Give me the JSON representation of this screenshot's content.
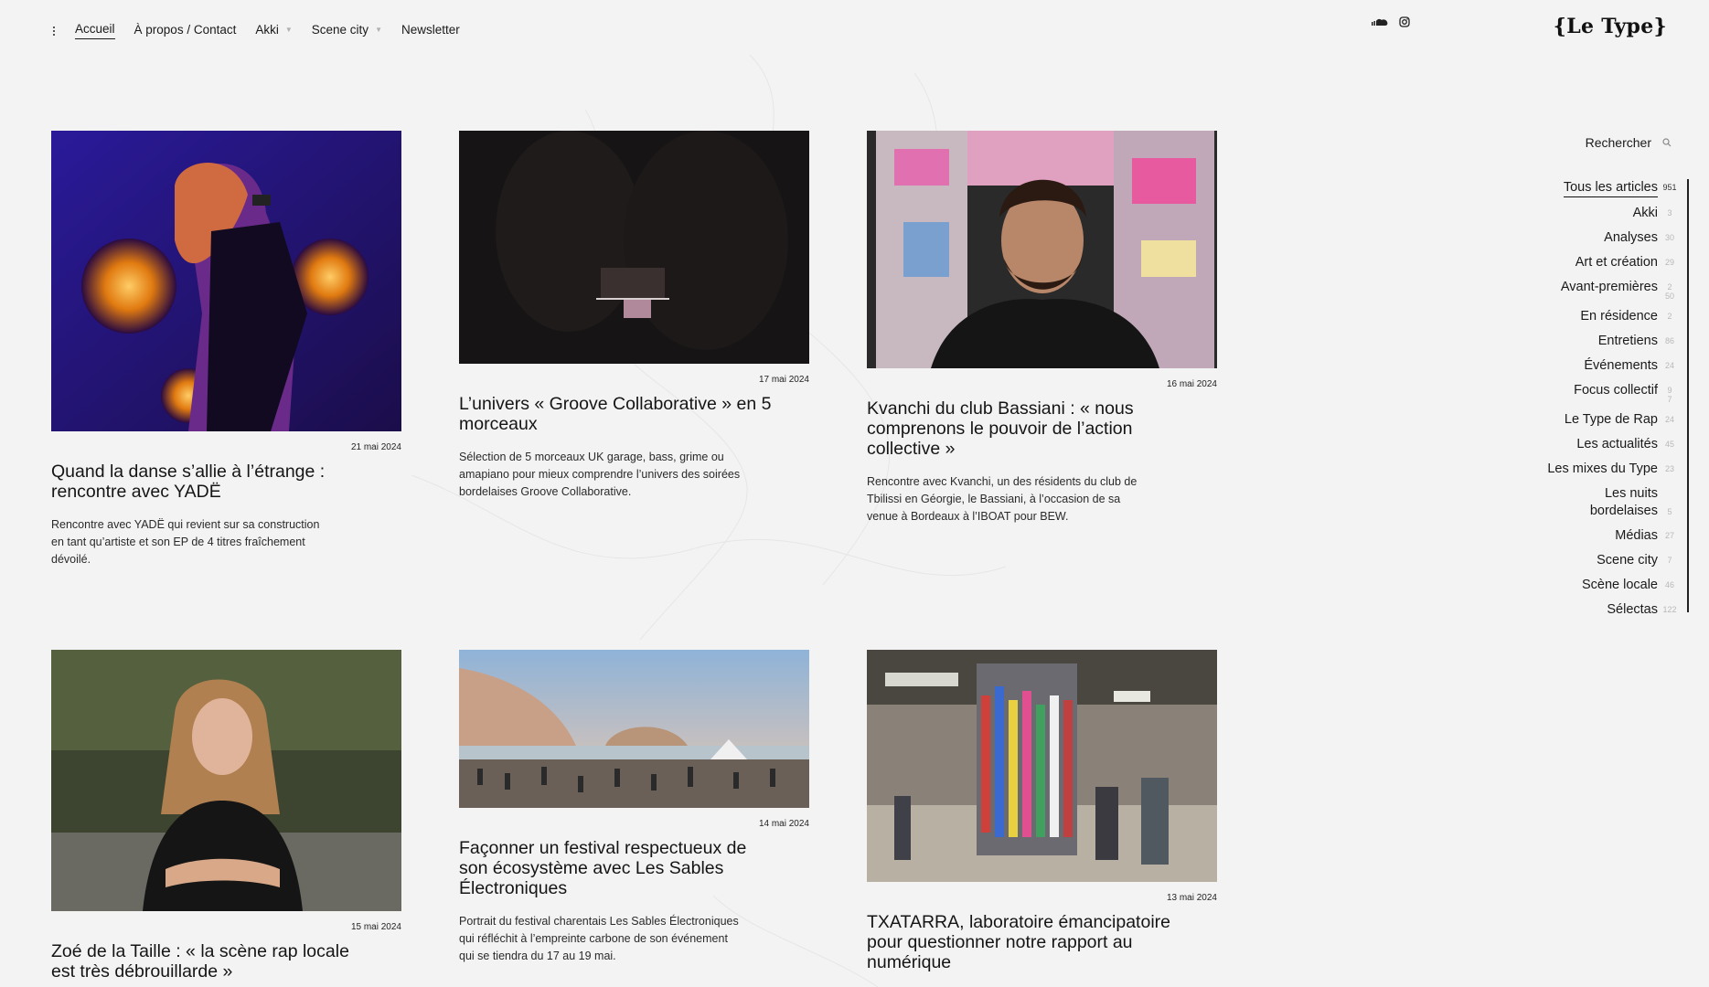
{
  "nav": {
    "items": [
      {
        "label": "Accueil",
        "active": true,
        "dropdown": false
      },
      {
        "label": "À propos / Contact",
        "active": false,
        "dropdown": false
      },
      {
        "label": "Akki",
        "active": false,
        "dropdown": true
      },
      {
        "label": "Scene city",
        "active": false,
        "dropdown": true
      },
      {
        "label": "Newsletter",
        "active": false,
        "dropdown": false
      }
    ]
  },
  "icons": {
    "soundcloud": "soundcloud-icon",
    "instagram": "instagram-icon",
    "search": "search-icon",
    "menu": "kebab-menu-icon"
  },
  "logo": "{Le Type}",
  "search": {
    "label": "Rechercher"
  },
  "categories": [
    {
      "label": "Tous les articles",
      "count": "951",
      "active": true
    },
    {
      "label": "Akki",
      "count": "3"
    },
    {
      "label": "Analyses",
      "count": "30"
    },
    {
      "label": "Art et création",
      "count": "29"
    },
    {
      "label": "Avant-premières",
      "count": "50",
      "extra": "2"
    },
    {
      "label": "En résidence",
      "count": "2"
    },
    {
      "label": "Entretiens",
      "count": "86"
    },
    {
      "label": "Événements",
      "count": "24"
    },
    {
      "label": "Focus collectif",
      "count": "7",
      "extra": "9"
    },
    {
      "label": "Le Type de Rap",
      "count": "24"
    },
    {
      "label": "Les actualités",
      "count": "45"
    },
    {
      "label": "Les mixes du Type",
      "count": "23"
    },
    {
      "label": "Les nuits bordelaises",
      "count": "5"
    },
    {
      "label": "Médias",
      "count": "27"
    },
    {
      "label": "Scene city",
      "count": "7"
    },
    {
      "label": "Scène locale",
      "count": "46"
    },
    {
      "label": "Sélectas",
      "count": "122"
    }
  ],
  "articles": [
    {
      "date": "21 mai 2024",
      "title": "Quand la danse s’allie à l’étrange : rencontre avec YADË",
      "excerpt": "Rencontre avec YADË qui revient sur sa construction en tant qu’artiste et son EP de 4 titres fraîchement dévoilé."
    },
    {
      "date": "17 mai 2024",
      "title": "L’univers « Groove Collaborative » en 5 morceaux",
      "excerpt": "Sélection de 5 morceaux UK garage, bass, grime ou amapiano pour mieux comprendre l’univers des soirées bordelaises Groove Collaborative."
    },
    {
      "date": "16 mai 2024",
      "title": "Kvanchi du club Bassiani : « nous comprenons le pouvoir de l’action collective »",
      "excerpt": "Rencontre avec Kvanchi, un des résidents du club de Tbilissi en Géorgie, le Bassiani, à l’occasion de sa venue à Bordeaux à l’IBOAT pour BEW."
    },
    {
      "date": "15 mai 2024",
      "title": "Zoé de la Taille : « la scène rap locale est très débrouillarde »",
      "excerpt": ""
    },
    {
      "date": "14 mai 2024",
      "title": "Façonner un festival respectueux de son écosystème avec Les Sables Électroniques",
      "excerpt": "Portrait du festival charentais Les Sables Électroniques qui réfléchit à l’empreinte carbone de son événement qui se tiendra du 17 au 19 mai."
    },
    {
      "date": "13 mai 2024",
      "title": "TXATARRA, laboratoire émancipatoire pour questionner notre rapport au numérique",
      "excerpt": ""
    }
  ]
}
